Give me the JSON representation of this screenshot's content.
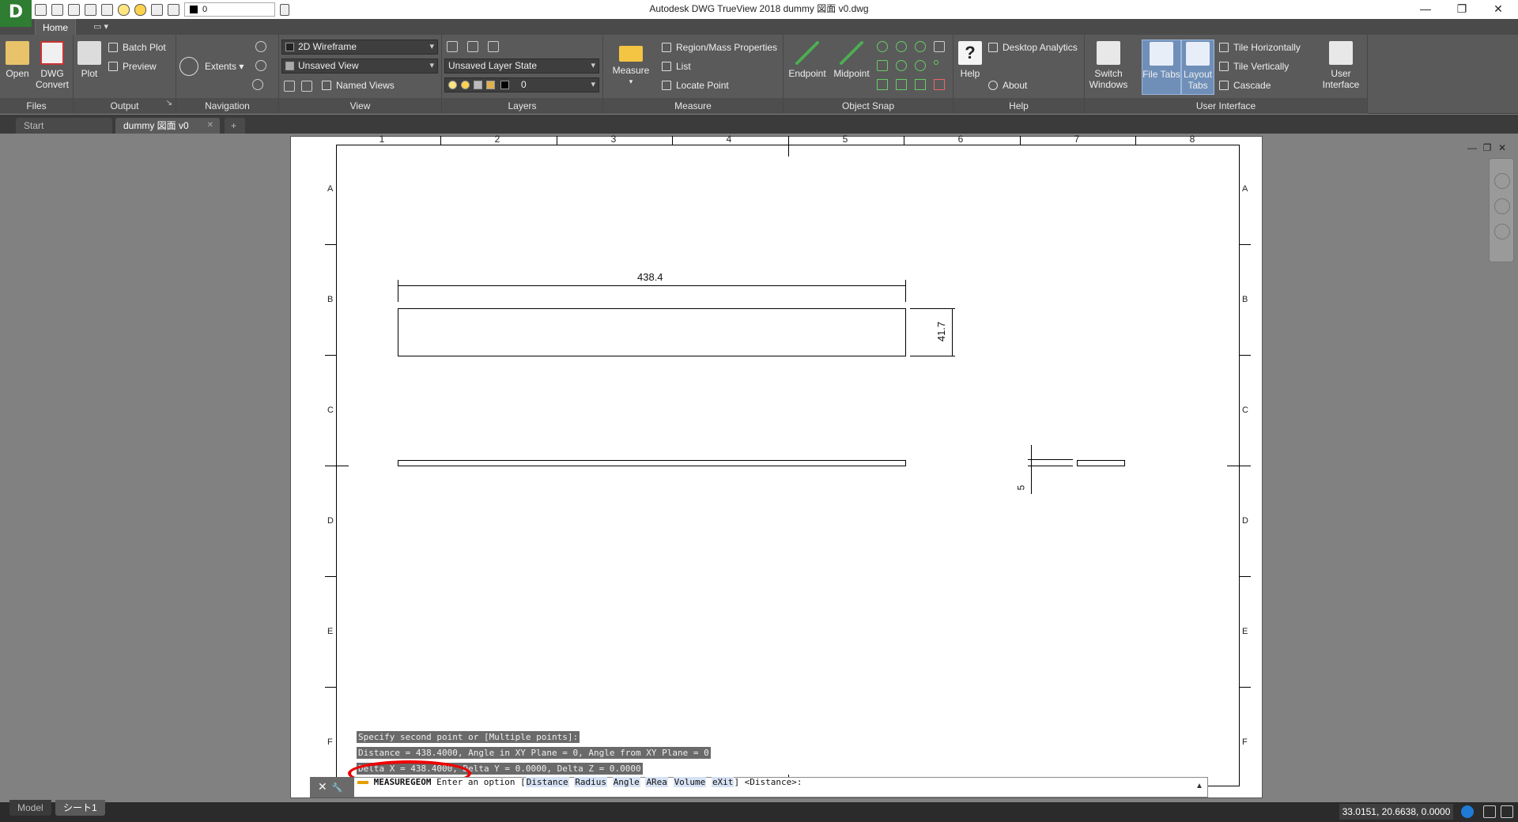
{
  "app": {
    "logo": "D",
    "title": "Autodesk DWG TrueView 2018   dummy 図面 v0.dwg",
    "qat_layer": "0",
    "min_glyph": "—",
    "restore_glyph": "❐",
    "close_glyph": "✕"
  },
  "ribbon_tabs": {
    "home": "Home",
    "extra": "▭ ▾"
  },
  "ribbon": {
    "files": {
      "label": "Files",
      "open": "Open",
      "dwg": "DWG",
      "convert": "Convert"
    },
    "output": {
      "label": "Output",
      "plot": "Plot",
      "batch_plot": "Batch Plot",
      "preview": "Preview",
      "expander": "↘"
    },
    "navigation": {
      "label": "Navigation",
      "extents": "Extents ▾"
    },
    "view": {
      "label": "View",
      "visual_style": "2D Wireframe",
      "named_view": "Unsaved View",
      "named_views": "Named Views"
    },
    "layers": {
      "label": "Layers",
      "layer_state": "Unsaved Layer State",
      "layer_current": "0"
    },
    "measure": {
      "label": "Measure",
      "measure": "Measure",
      "region": "Region/Mass Properties",
      "list": "List",
      "locate": "Locate Point"
    },
    "osnap": {
      "label": "Object Snap",
      "endpoint": "Endpoint",
      "midpoint": "Midpoint"
    },
    "help": {
      "label": "Help",
      "help": "Help",
      "desktop_analytics": "Desktop Analytics",
      "about": "About"
    },
    "ui": {
      "label": "User Interface",
      "switch": "Switch",
      "windows": "Windows",
      "file_tabs": "File Tabs",
      "layout": "Layout",
      "tabs": "Tabs",
      "tile_h": "Tile Horizontally",
      "tile_v": "Tile Vertically",
      "cascade": "Cascade",
      "user": "User",
      "interface": "Interface"
    }
  },
  "doc_tabs": {
    "start": "Start",
    "active": "dummy 図面 v0",
    "close": "✕",
    "add": "+"
  },
  "drawing": {
    "columns": [
      "1",
      "2",
      "3",
      "4",
      "5",
      "6",
      "7",
      "8"
    ],
    "rows": [
      "A",
      "B",
      "C",
      "D",
      "E",
      "F"
    ],
    "dim_width": "438.4",
    "dim_height": "41.7",
    "dim_small": "5"
  },
  "view_controls": {
    "min": "—",
    "restore": "❐",
    "close": "✕"
  },
  "command": {
    "hist1": "Specify second point or [Multiple points]:",
    "hist2": "Distance = 438.4000,  Angle in XY Plane = 0,  Angle from XY Plane = 0",
    "hist3": "Delta X = 438.4000,  Delta Y = 0.0000,   Delta Z = 0.0000",
    "cmd": "MEASUREGEOM",
    "prompt": "Enter an option [",
    "options": [
      "Distance",
      "Radius",
      "Angle",
      "ARea",
      "Volume",
      "eXit"
    ],
    "suffix": "] <Distance>:",
    "close_glyph": "✕",
    "wrench_glyph": "🔧",
    "up_glyph": "▲"
  },
  "layout_tabs": {
    "model": "Model",
    "sheet": "シート1"
  },
  "status": {
    "coords": "33.0151, 20.6638, 0.0000"
  }
}
